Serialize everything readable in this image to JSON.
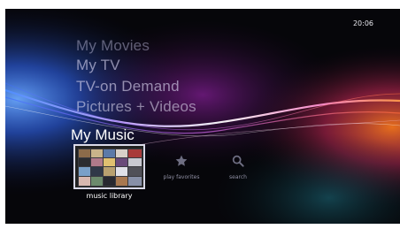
{
  "clock": {
    "time": "20:06"
  },
  "menu": {
    "items": [
      {
        "label": "My Movies"
      },
      {
        "label": "My TV"
      },
      {
        "label": "TV-on Demand"
      },
      {
        "label": "Pictures + Videos"
      }
    ],
    "selected": {
      "label": "My Music"
    }
  },
  "strip": {
    "selected_tile": {
      "label": "music library",
      "icon": "album-grid-icon"
    },
    "options": [
      {
        "label": "play favorites",
        "icon": "star-icon"
      },
      {
        "label": "search",
        "icon": "search-icon"
      }
    ]
  },
  "colors": {
    "background": "#06060a",
    "accent_blue": "#2f6bff",
    "accent_magenta": "#c02cc8",
    "accent_orange": "#ff6a1a"
  }
}
